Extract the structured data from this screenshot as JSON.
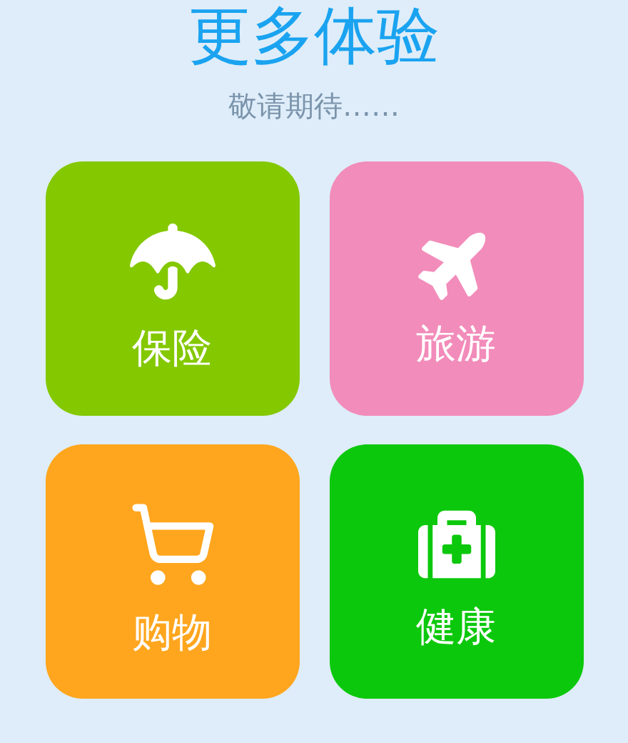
{
  "title": "更多体验",
  "subtitle": "敬请期待……",
  "tiles": [
    {
      "label": "保险",
      "kind": "umbrella",
      "color": "#84c800"
    },
    {
      "label": "旅游",
      "kind": "plane",
      "color": "#f28cba"
    },
    {
      "label": "购物",
      "kind": "cart",
      "color": "#ffa61e"
    },
    {
      "label": "健康",
      "kind": "medkit",
      "color": "#0cc80c"
    }
  ]
}
